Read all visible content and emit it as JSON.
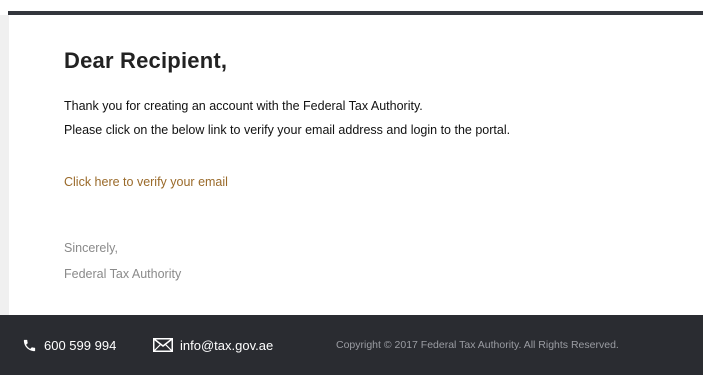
{
  "email": {
    "greeting": "Dear Recipient,",
    "body_lines": [
      "Thank you for creating an account with the Federal Tax Authority.",
      "Please click on the below link to verify your email address and login to the portal."
    ],
    "verify_link_label": "Click here to verify your email",
    "signoff": {
      "closing": "Sincerely,",
      "sender": "Federal Tax Authority"
    }
  },
  "footer": {
    "phone": "600 599 994",
    "email": "info@tax.gov.ae",
    "copyright": "Copyright © 2017  Federal Tax Authority. All Rights Reserved."
  },
  "icons": {
    "phone": "phone-icon",
    "email": "envelope-icon"
  },
  "colors": {
    "link": "#9a6a2a",
    "footer_background": "#2a2c31",
    "top_bar": "#33363d",
    "signoff_text": "#8a8a8a",
    "copyright_text": "#9a9ca2"
  }
}
